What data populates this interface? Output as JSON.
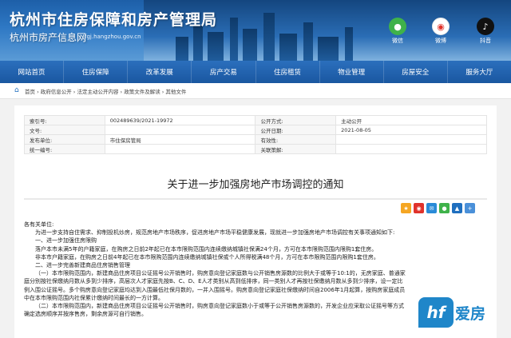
{
  "header": {
    "site_title": "杭州市住房保障和房产管理局",
    "site_subtitle": "杭州市房产信息网",
    "site_url": "fgj.hangzhou.gov.cn",
    "social": [
      {
        "label": "微信",
        "icon": "wechat-icon"
      },
      {
        "label": "微博",
        "icon": "weibo-icon"
      },
      {
        "label": "抖音",
        "icon": "douyin-icon"
      }
    ]
  },
  "nav": {
    "items": [
      "网站首页",
      "住房保障",
      "改革发展",
      "房产交易",
      "住房租赁",
      "物业管理",
      "房屋安全",
      "服务大厅"
    ]
  },
  "breadcrumb": {
    "text": "首页 › 政府信息公开 › 法定主动公开内容 › 政策文件及解读 › 其他文件"
  },
  "meta": {
    "rows": [
      {
        "l1": "索引号:",
        "v1": "002489639/2021-19972",
        "l2": "公开方式:",
        "v2": "主动公开"
      },
      {
        "l1": "文号:",
        "v1": "",
        "l2": "公开日期:",
        "v2": "2021-08-05"
      },
      {
        "l1": "发布单位:",
        "v1": "市住保房管局",
        "l2": "有效性:",
        "v2": ""
      },
      {
        "l1": "统一编号:",
        "v1": "",
        "l2": "关联策解:",
        "v2": ""
      }
    ]
  },
  "document": {
    "title": "关于进一步加强房地产市场调控的通知",
    "paragraphs": [
      "各有关单位:",
      "为进一步支持自住需求、抑制投机炒房，规范房地产市场秩序，促进房地产市场平稳健康发展，现就进一步加强房地产市场调控有关事项通知如下:",
      "一、进一步加强住房限购",
      "落户本市未满5年的户籍家庭，在购房之日前2年起已在本市限购范围内连续缴纳城镇社保满24个月，方可在本市限购范围内限购1套住房。",
      "非本市户籍家庭，在购房之日前4年起已在本市限购范围内连续缴纳城镇社保或个人所得税满48个月，方可在本市限购范围内限购1套住房。",
      "二、进一步完善新建商品住房销售管理",
      "（一）本市限购范围内，新建商品住房项目公证摇号公开销售时，购房意向登记家庭数与公开销售房源数的比例大于或等于10:1的，无房家庭、普通家",
      "庭分别按社保缴纳月数从多到少排序，高层次人才家庭先按B、C、D、E人才类别从高到低排序，同一类别人才再按社保缴纳月数从多到少排序，设一定比",
      "例入围公证摇号。多个购房意向登记家庭均达到入围最低社保月数的，一并入围摇号。购房意向登记家庭社保缴纳时间自2006年1月起算，按购房家庭成员",
      "中在本市限购范围内社保累计缴纳时间最长的一方计算。",
      "（二）本市限购范围内，新建商品住房项目公证摇号公开销售时，购房意向登记家庭数小于或等于公开销售房源数的，开发企业应采取公证摇号等方式",
      "确定选房顺序并按序售房，剩余房源可自行销售。"
    ]
  },
  "share_icons": [
    "share-qzone-icon",
    "share-weibo-icon",
    "share-tencent-icon",
    "share-wechat-icon",
    "share-renren-icon",
    "share-more-icon"
  ],
  "watermark": {
    "logo": "hf",
    "text": "爱房"
  }
}
